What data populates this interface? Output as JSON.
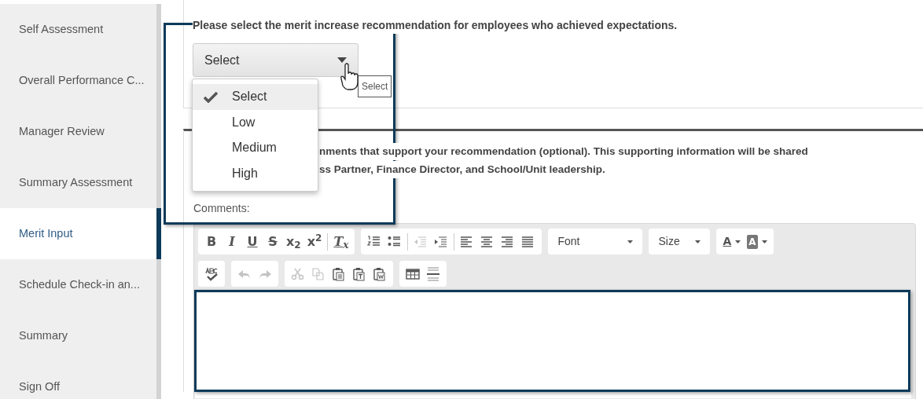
{
  "sidebar": {
    "items": [
      {
        "label": "Self Assessment",
        "selected": false
      },
      {
        "label": "Overall Performance C...",
        "selected": false
      },
      {
        "label": "Manager Review",
        "selected": false
      },
      {
        "label": "Summary Assessment",
        "selected": false
      },
      {
        "label": "Merit Input",
        "selected": true
      },
      {
        "label": "Schedule Check-in an...",
        "selected": false
      },
      {
        "label": "Summary",
        "selected": false
      },
      {
        "label": "Sign Off",
        "selected": false
      }
    ]
  },
  "merit": {
    "question": "Please select the merit increase recommendation for employees who achieved expectations.",
    "select": {
      "value": "Select"
    },
    "tooltip": "Select",
    "menu": [
      {
        "label": "Select",
        "selected": true
      },
      {
        "label": "Low",
        "selected": false
      },
      {
        "label": "Medium",
        "selected": false
      },
      {
        "label": "High",
        "selected": false
      }
    ]
  },
  "comments": {
    "prompt_lines": [
      "nments that support your recommendation (optional). This supporting information will be shared",
      "ss Partner, Finance Director, and School/Unit leadership."
    ],
    "label": "Comments:",
    "toolbar_rows": [
      [
        {
          "buttons": [
            {
              "kind": "bold",
              "text": "B",
              "disabled": false
            },
            {
              "kind": "italic",
              "text": "I",
              "disabled": false
            },
            {
              "kind": "underline",
              "text": "U",
              "disabled": false
            },
            {
              "kind": "strike",
              "text": "S",
              "disabled": false
            },
            {
              "kind": "subscript",
              "text": "x$_{2}$",
              "disabled": false
            },
            {
              "kind": "superscript",
              "text": "x$^{2}$",
              "disabled": false
            },
            {
              "kind": "separator"
            },
            {
              "kind": "clear-format",
              "text": "T$_{x}$",
              "disabled": false
            }
          ]
        },
        {
          "buttons": [
            {
              "kind": "ordered-list",
              "disabled": false
            },
            {
              "kind": "bullet-list",
              "disabled": false
            },
            {
              "kind": "separator"
            },
            {
              "kind": "outdent",
              "disabled": true
            },
            {
              "kind": "indent",
              "disabled": false
            },
            {
              "kind": "separator"
            },
            {
              "kind": "align-left",
              "disabled": false
            },
            {
              "kind": "align-center",
              "disabled": false
            },
            {
              "kind": "align-right",
              "disabled": false
            },
            {
              "kind": "justify",
              "disabled": false
            }
          ]
        },
        {
          "buttons": [
            {
              "kind": "font",
              "text": "Font"
            }
          ]
        },
        {
          "buttons": [
            {
              "kind": "size",
              "text": "Size"
            }
          ]
        },
        {
          "buttons": [
            {
              "kind": "text-color",
              "text": "A"
            },
            {
              "kind": "background-color",
              "text": "A"
            }
          ]
        }
      ],
      [
        {
          "buttons": [
            {
              "kind": "spellcheck",
              "disabled": false
            }
          ]
        },
        {
          "buttons": [
            {
              "kind": "undo",
              "disabled": true
            },
            {
              "kind": "redo",
              "disabled": true
            }
          ]
        },
        {
          "buttons": [
            {
              "kind": "cut",
              "disabled": true
            },
            {
              "kind": "copy",
              "disabled": true
            },
            {
              "kind": "paste",
              "disabled": false
            },
            {
              "kind": "paste-text",
              "disabled": false
            },
            {
              "kind": "paste-word",
              "disabled": false
            }
          ]
        },
        {
          "buttons": [
            {
              "kind": "table",
              "disabled": false
            },
            {
              "kind": "horizontal-rule",
              "disabled": false
            }
          ]
        }
      ]
    ]
  }
}
